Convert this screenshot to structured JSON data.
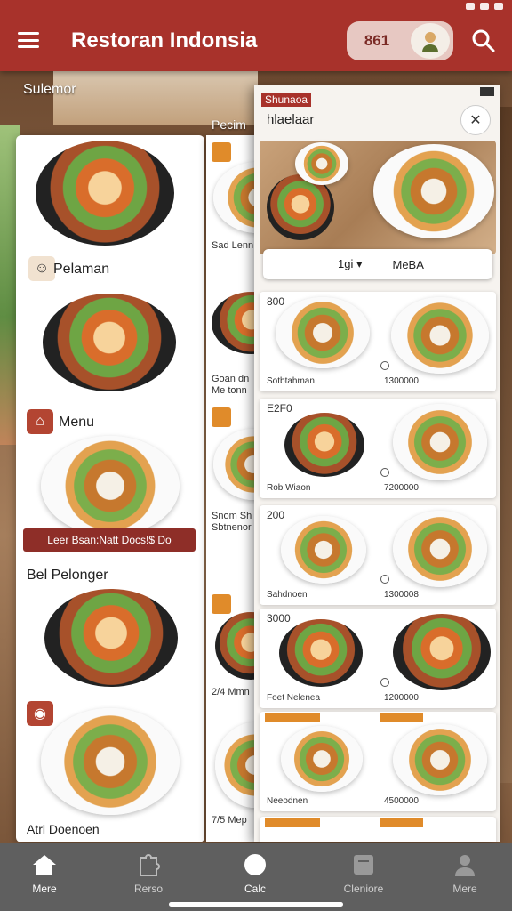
{
  "app": {
    "title": "Restoran Indonsia",
    "pill_text": "861",
    "colors": {
      "primary": "#a8322b",
      "accent": "#e08b2a",
      "nav_bg": "#5f5f5f"
    }
  },
  "overlay_labels": {
    "left_top": "Sulemor",
    "mid_top": "Pecim"
  },
  "left_panel": {
    "section1": "Pelaman",
    "section2": "Menu",
    "banner": "Leer Bsan:Natt  Docs!$ Do",
    "section3": "Bel Pelonger",
    "footer": "Atrl Doenoen"
  },
  "mid_strip": {
    "labels": [
      "Sad Lenn",
      "Goan dn Me tonn",
      "Snom Sh Sbtnenor",
      "2/4 Mmn",
      "7/5 Mep"
    ]
  },
  "right_panel": {
    "tag": "Shunaoa",
    "title": "hlaelaar",
    "filter_left": "1gi ▾",
    "filter_right": "MeBA",
    "cards": [
      {
        "price": "800",
        "name": "Sotbtahman",
        "amount": "1300000"
      },
      {
        "price": "E2F0",
        "name": "Rob Wiaon",
        "amount": "7200000"
      },
      {
        "price": "200",
        "name": "Sahdnoen",
        "amount": "1300008"
      },
      {
        "price": "3000",
        "name": "Foet Nelenea",
        "amount": "1200000"
      },
      {
        "price": "",
        "name": "Neeodnen",
        "amount": "4500000"
      }
    ]
  },
  "bottom_nav": [
    {
      "label": "Mere",
      "icon": "home-icon"
    },
    {
      "label": "Rerso",
      "icon": "puzzle-icon"
    },
    {
      "label": "Calc",
      "icon": "circle-icon"
    },
    {
      "label": "Cleniore",
      "icon": "document-icon"
    },
    {
      "label": "Mere",
      "icon": "person-icon"
    }
  ]
}
